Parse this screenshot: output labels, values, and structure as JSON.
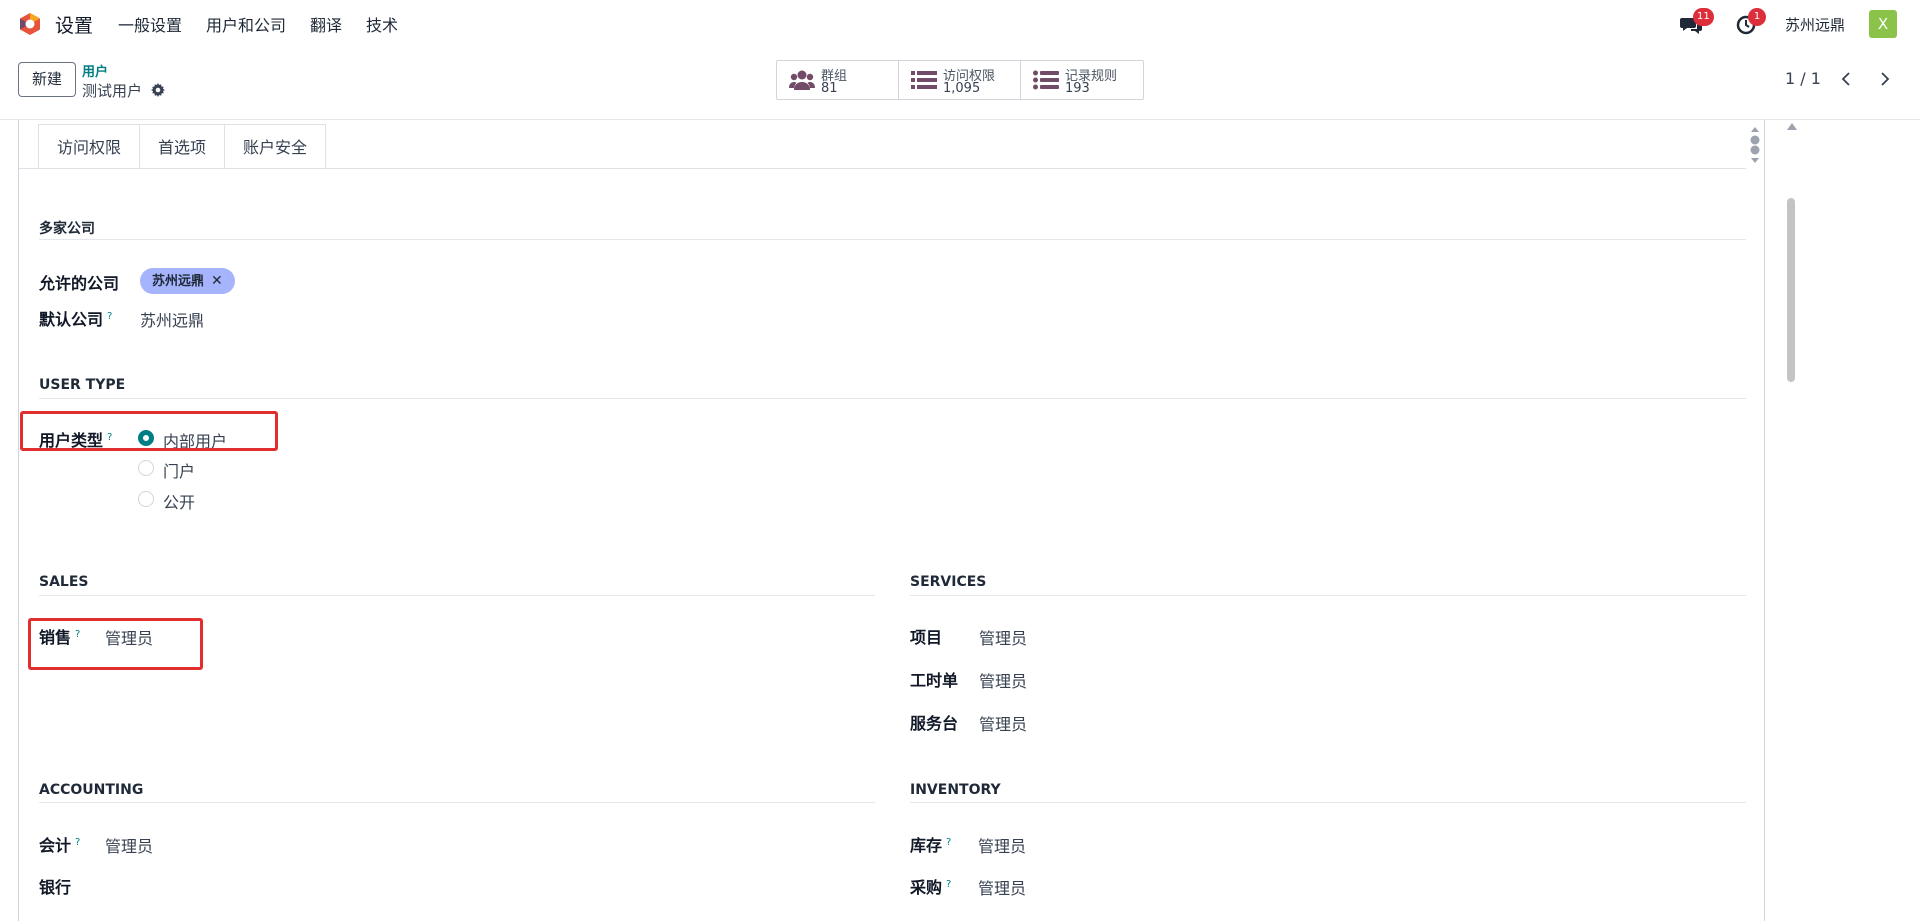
{
  "navbar": {
    "app_title": "设置",
    "menu": [
      "一般设置",
      "用户和公司",
      "翻译",
      "技术"
    ],
    "messages_badge": "11",
    "activities_badge": "1",
    "company": "苏州远鼎",
    "avatar_letter": "X"
  },
  "control": {
    "new_label": "新建",
    "breadcrumb_parent": "用户",
    "breadcrumb_current": "测试用户",
    "smart_buttons": [
      {
        "label": "群组",
        "value": "81",
        "icon": "users-icon"
      },
      {
        "label": "访问权限",
        "value": "1,095",
        "icon": "list-icon"
      },
      {
        "label": "记录规则",
        "value": "193",
        "icon": "list-icon"
      }
    ],
    "pager": "1 / 1"
  },
  "tabs": [
    "访问权限",
    "首选项",
    "账户安全"
  ],
  "sections": {
    "multi_company": {
      "title": "多家公司",
      "allowed_label": "允许的公司",
      "allowed_tag": "苏州远鼎",
      "default_label": "默认公司",
      "default_value": "苏州远鼎"
    },
    "user_type": {
      "title": "USER TYPE",
      "label": "用户类型",
      "options": [
        "内部用户",
        "门户",
        "公开"
      ],
      "selected": "内部用户"
    },
    "sales": {
      "title": "SALES",
      "fields": [
        {
          "label": "销售",
          "value": "管理员"
        }
      ]
    },
    "services": {
      "title": "SERVICES",
      "fields": [
        {
          "label": "项目",
          "value": "管理员"
        },
        {
          "label": "工时单",
          "value": "管理员"
        },
        {
          "label": "服务台",
          "value": "管理员"
        }
      ]
    },
    "accounting": {
      "title": "ACCOUNTING",
      "fields": [
        {
          "label": "会计",
          "value": "管理员"
        },
        {
          "label": "银行",
          "value": ""
        }
      ]
    },
    "inventory": {
      "title": "INVENTORY",
      "fields": [
        {
          "label": "库存",
          "value": "管理员"
        },
        {
          "label": "采购",
          "value": "管理员"
        }
      ]
    }
  },
  "help_mark": "?",
  "colors": {
    "accent": "#017e84",
    "tag": "#a5b4fc",
    "highlight": "#e02d2d",
    "badge": "#dc2f3b"
  }
}
